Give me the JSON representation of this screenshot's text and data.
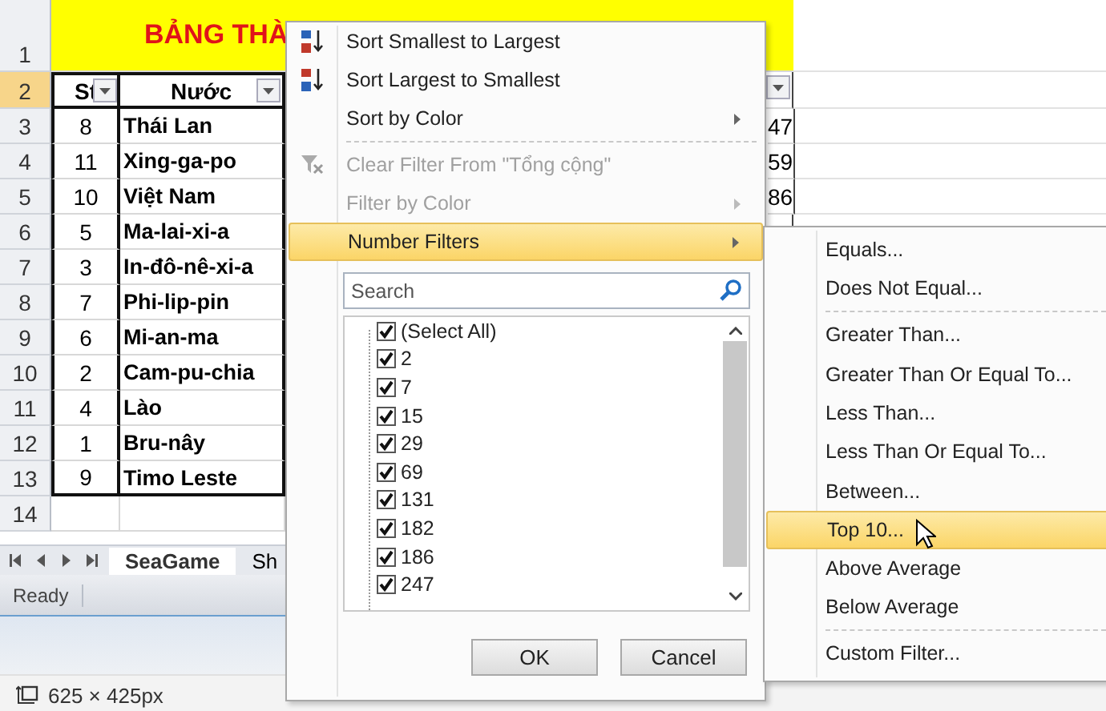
{
  "sheet": {
    "title": "BẢNG THÀ",
    "row_numbers": [
      {
        "label": "1",
        "selected": false
      },
      {
        "label": "2",
        "selected": true
      },
      {
        "label": "3",
        "selected": false
      },
      {
        "label": "4",
        "selected": false
      },
      {
        "label": "5",
        "selected": false
      },
      {
        "label": "6",
        "selected": false
      },
      {
        "label": "7",
        "selected": false
      },
      {
        "label": "8",
        "selected": false
      },
      {
        "label": "9",
        "selected": false
      },
      {
        "label": "10",
        "selected": false
      },
      {
        "label": "11",
        "selected": false
      },
      {
        "label": "12",
        "selected": false
      },
      {
        "label": "13",
        "selected": false
      },
      {
        "label": "14",
        "selected": false
      }
    ],
    "headers": [
      "St",
      "Nước"
    ],
    "rows": [
      {
        "rank": "8",
        "country": "Thái Lan",
        "right_column": "47"
      },
      {
        "rank": "11",
        "country": "Xing-ga-po",
        "right_column": "59"
      },
      {
        "rank": "10",
        "country": "Việt Nam",
        "right_column": "86"
      },
      {
        "rank": "5",
        "country": "Ma-lai-xi-a"
      },
      {
        "rank": "3",
        "country": "In-đô-nê-xi-a"
      },
      {
        "rank": "7",
        "country": "Phi-lip-pin"
      },
      {
        "rank": "6",
        "country": "Mi-an-ma"
      },
      {
        "rank": "2",
        "country": "Cam-pu-chia"
      },
      {
        "rank": "4",
        "country": "Lào"
      },
      {
        "rank": "1",
        "country": "Bru-nây"
      },
      {
        "rank": "9",
        "country": "Timo Leste"
      }
    ]
  },
  "sheet_tabs": [
    {
      "label": "SeaGame",
      "selected": true
    },
    {
      "label": "Sh",
      "selected": false
    }
  ],
  "status_bar": {
    "text": "Ready"
  },
  "footer": {
    "text": "625 × 425px"
  },
  "filter_menu": {
    "items": [
      {
        "label": "Sort Smallest to Largest",
        "kind": "sort-asc",
        "disabled": false,
        "selected": false,
        "submenu": false,
        "separator_after": false
      },
      {
        "label": "Sort Largest to Smallest",
        "kind": "sort-desc",
        "disabled": false,
        "selected": false,
        "submenu": false,
        "separator_after": false
      },
      {
        "label": "Sort by Color",
        "kind": "plain",
        "disabled": false,
        "selected": false,
        "submenu": true,
        "separator_after": true
      },
      {
        "label": "Clear Filter From \"Tổng cộng\"",
        "kind": "clear-filter",
        "disabled": true,
        "selected": false,
        "submenu": false,
        "separator_after": false
      },
      {
        "label": "Filter by Color",
        "kind": "plain",
        "disabled": true,
        "selected": false,
        "submenu": true,
        "separator_after": false
      },
      {
        "label": "Number Filters",
        "kind": "plain",
        "disabled": false,
        "selected": true,
        "submenu": true,
        "separator_after": false
      }
    ],
    "search": {
      "placeholder": "Search"
    },
    "values": [
      {
        "label": "(Select All)",
        "checked": true
      },
      {
        "label": "2",
        "checked": true
      },
      {
        "label": "7",
        "checked": true
      },
      {
        "label": "15",
        "checked": true
      },
      {
        "label": "29",
        "checked": true
      },
      {
        "label": "69",
        "checked": true
      },
      {
        "label": "131",
        "checked": true
      },
      {
        "label": "182",
        "checked": true
      },
      {
        "label": "186",
        "checked": true
      },
      {
        "label": "247",
        "checked": true
      }
    ],
    "buttons": [
      "OK",
      "Cancel"
    ]
  },
  "number_filters": {
    "items": [
      {
        "label": "Equals...",
        "selected": false,
        "separator_after": false
      },
      {
        "label": "Does Not Equal...",
        "selected": false,
        "separator_after": true
      },
      {
        "label": "Greater Than...",
        "selected": false,
        "separator_after": false
      },
      {
        "label": "Greater Than Or Equal To...",
        "selected": false,
        "separator_after": false
      },
      {
        "label": "Less Than...",
        "selected": false,
        "separator_after": false
      },
      {
        "label": "Less Than Or Equal To...",
        "selected": false,
        "separator_after": false
      },
      {
        "label": "Between...",
        "selected": false,
        "separator_after": false
      },
      {
        "label": "Top 10...",
        "selected": true,
        "separator_after": false
      },
      {
        "label": "Above Average",
        "selected": false,
        "separator_after": false
      },
      {
        "label": "Below Average",
        "selected": false,
        "separator_after": true
      },
      {
        "label": "Custom Filter...",
        "selected": false,
        "separator_after": false
      }
    ]
  }
}
